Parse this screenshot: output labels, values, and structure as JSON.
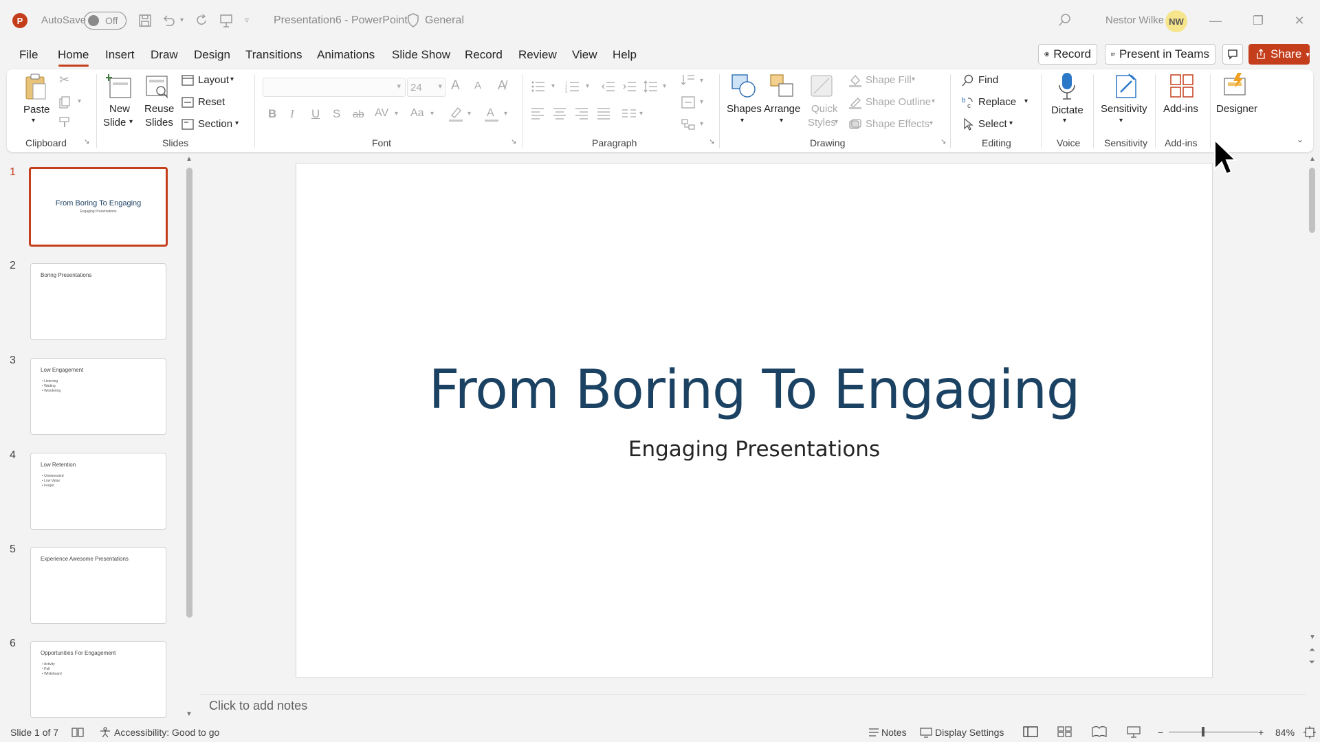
{
  "titlebar": {
    "app_initial": "P",
    "autosave_label": "AutoSave",
    "autosave_state": "Off",
    "document_title": "Presentation6  -  PowerPoint",
    "sensitivity": "General",
    "user_name": "Nestor Wilke",
    "user_initials": "NW"
  },
  "menu": {
    "tabs": [
      "File",
      "Home",
      "Insert",
      "Draw",
      "Design",
      "Transitions",
      "Animations",
      "Slide Show",
      "Record",
      "Review",
      "View",
      "Help"
    ],
    "active_tab": "Home",
    "record_button": "Record",
    "present_teams_button": "Present in Teams",
    "share_button": "Share"
  },
  "ribbon": {
    "clipboard": {
      "paste": "Paste",
      "group": "Clipboard"
    },
    "slides": {
      "new_slide_1": "New",
      "new_slide_2": "Slide",
      "reuse_1": "Reuse",
      "reuse_2": "Slides",
      "layout": "Layout",
      "reset": "Reset",
      "section": "Section",
      "group": "Slides"
    },
    "font": {
      "font_size": "24",
      "bold": "B",
      "italic": "I",
      "underline": "U",
      "shadow": "S",
      "strike": "ab",
      "spacing": "AV",
      "case": "Aa",
      "grow": "A",
      "shrink": "A",
      "group": "Font"
    },
    "paragraph": {
      "group": "Paragraph"
    },
    "drawing": {
      "shapes": "Shapes",
      "arrange": "Arrange",
      "quick_1": "Quick",
      "quick_2": "Styles",
      "shape_fill": "Shape Fill",
      "shape_outline": "Shape Outline",
      "shape_effects": "Shape Effects",
      "group": "Drawing"
    },
    "editing": {
      "find": "Find",
      "replace": "Replace",
      "select": "Select",
      "group": "Editing"
    },
    "voice": {
      "dictate": "Dictate",
      "group": "Voice"
    },
    "sensitivity": {
      "label": "Sensitivity",
      "group": "Sensitivity"
    },
    "addins": {
      "label": "Add-ins",
      "group": "Add-ins"
    },
    "designer": {
      "label": "Designer"
    }
  },
  "slides": [
    {
      "number": "1",
      "title": "From Boring To Engaging",
      "subtitle": "Engaging Presentations",
      "bullets": []
    },
    {
      "number": "2",
      "title": "Boring Presentations",
      "bullets": []
    },
    {
      "number": "3",
      "title": "Low Engagement",
      "bullets": [
        "• Listening",
        "• Waiting",
        "• Wondering"
      ]
    },
    {
      "number": "4",
      "title": "Low Retention",
      "bullets": [
        "• Uninterested",
        "• Low Value",
        "• Forget"
      ]
    },
    {
      "number": "5",
      "title": "Experience Awesome Presentations",
      "bullets": []
    },
    {
      "number": "6",
      "title": "Opportunities For Engagement",
      "bullets": [
        "• Activity",
        "• Poll",
        "• Whiteboard"
      ]
    }
  ],
  "current_slide": {
    "title": "From Boring To Engaging",
    "subtitle": "Engaging Presentations",
    "title_color": "#1b4262"
  },
  "notes_placeholder": "Click to add notes",
  "statusbar": {
    "slide_counter": "Slide 1 of 7",
    "accessibility": "Accessibility: Good to go",
    "notes": "Notes",
    "display_settings": "Display Settings",
    "zoom": "84%"
  },
  "colors": {
    "accent": "#c43e1c",
    "title": "#1b4262"
  }
}
